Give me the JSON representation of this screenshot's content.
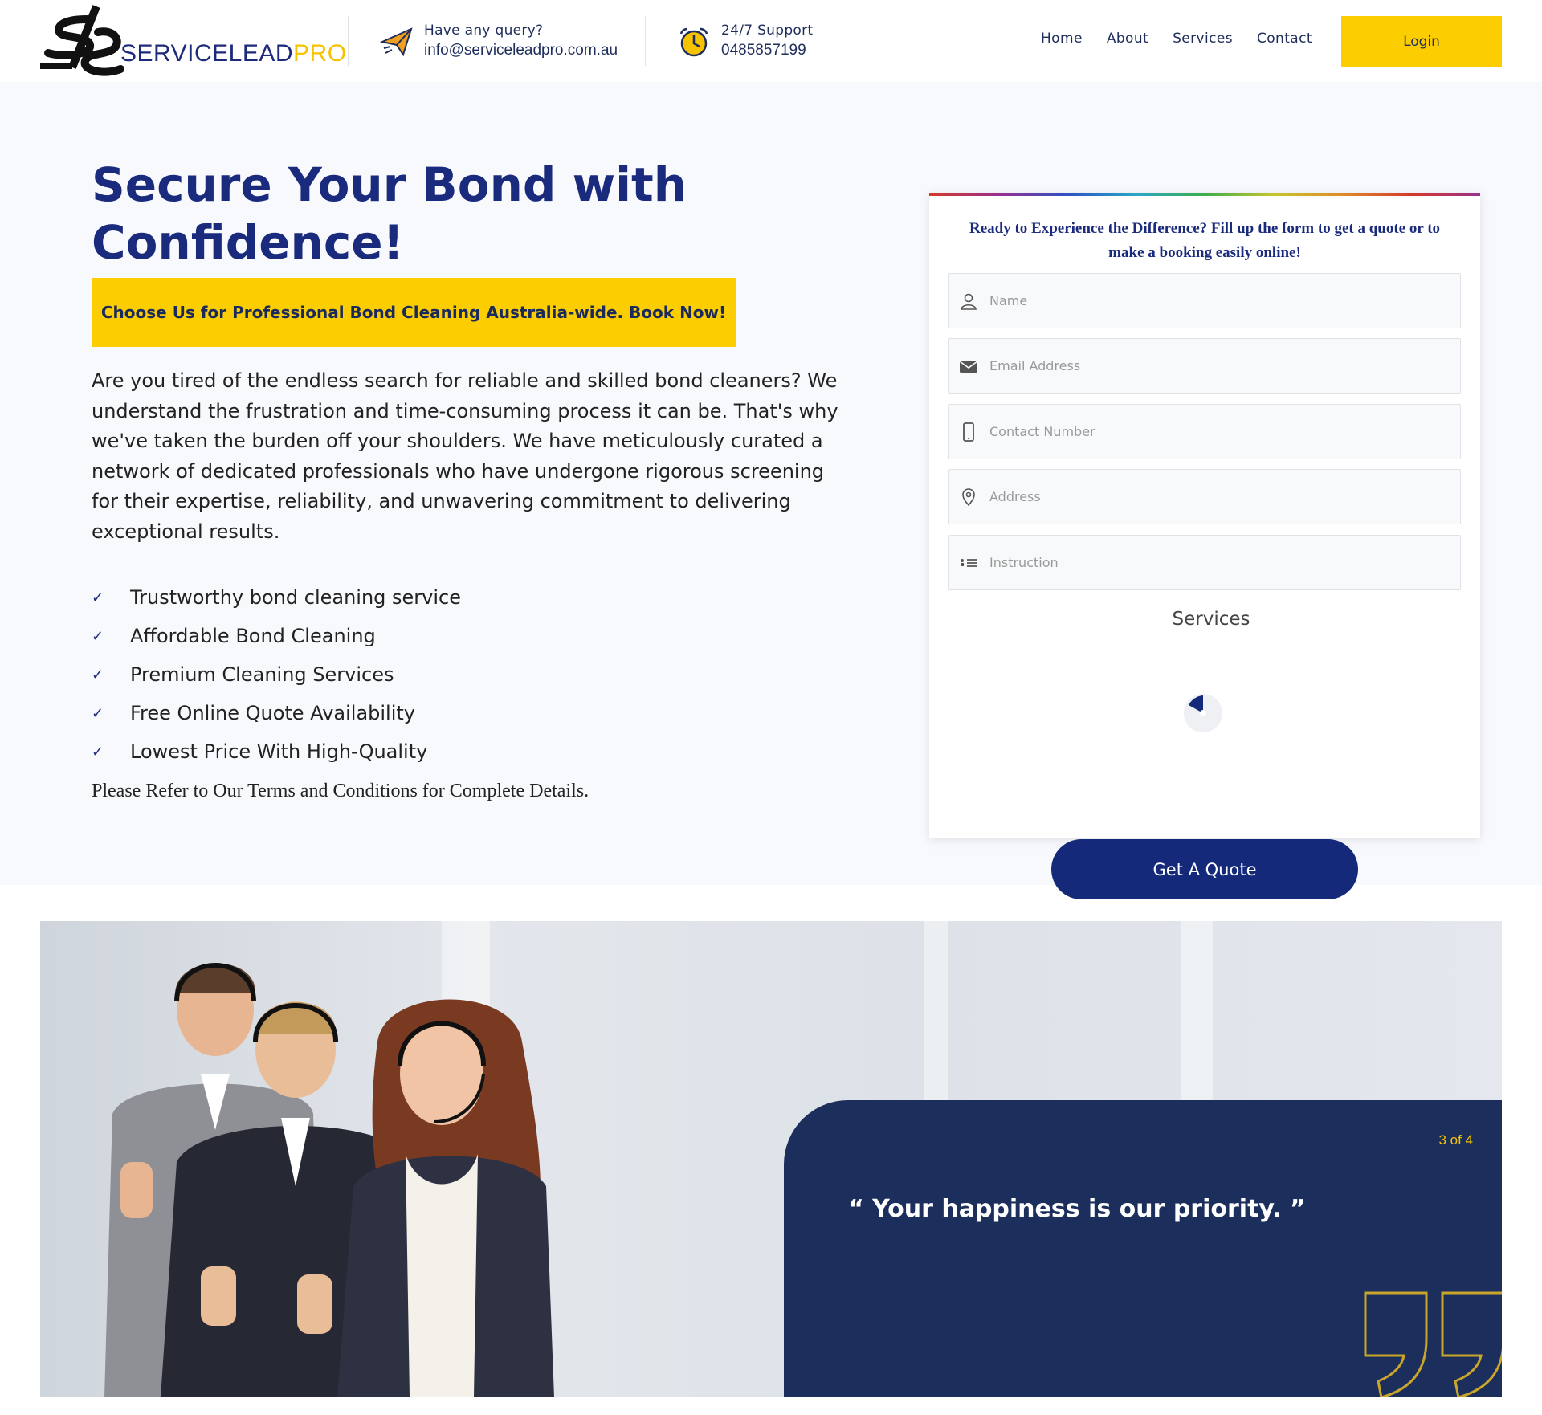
{
  "header": {
    "logo": {
      "name": "SERVICELEAD",
      "suffix": "PRO"
    },
    "query": {
      "title": "Have any query?",
      "value": "info@serviceleadpro.com.au",
      "icon": "paper-plane-icon"
    },
    "support": {
      "title": "24/7 Support",
      "value": "0485857199",
      "icon": "alarm-clock-icon"
    },
    "nav": [
      "Home",
      "About",
      "Services",
      "Contact"
    ],
    "login_label": "Login"
  },
  "hero": {
    "title": "Secure Your Bond with Confidence!",
    "promo": "Choose Us for Professional Bond Cleaning Australia-wide. Book Now!",
    "intro": "Are you tired of the endless search for reliable and skilled bond cleaners? We understand the frustration and time-consuming process it can be. That's why we've taken the burden off your shoulders. We have meticulously curated a network of dedicated professionals who have undergone rigorous screening for their expertise, reliability, and unwavering commitment to delivering exceptional results.",
    "features": [
      "Trustworthy bond cleaning service",
      "Affordable Bond Cleaning",
      "Premium Cleaning Services",
      "Free Online Quote Availability",
      "Lowest Price With High-Quality"
    ],
    "terms": "Please Refer to Our Terms and Conditions for Complete Details."
  },
  "form": {
    "intro": "Ready to Experience the Difference? Fill up the form to get a quote or to make a booking easily online!",
    "fields": [
      {
        "placeholder": "Name",
        "icon": "user-icon"
      },
      {
        "placeholder": "Email Address",
        "icon": "envelope-icon"
      },
      {
        "placeholder": "Contact Number",
        "icon": "phone-icon"
      },
      {
        "placeholder": "Address",
        "icon": "map-pin-icon"
      },
      {
        "placeholder": "Instruction",
        "icon": "list-icon"
      }
    ],
    "services_label": "Services",
    "submit_label": "Get A Quote"
  },
  "testimonial": {
    "pager": "3 of 4",
    "quote": "“ Your happiness is our priority. ”"
  },
  "colors": {
    "brand_navy": "#1a2a7c",
    "accent_yellow": "#fccd00",
    "panel_navy": "#1b2e5c"
  }
}
